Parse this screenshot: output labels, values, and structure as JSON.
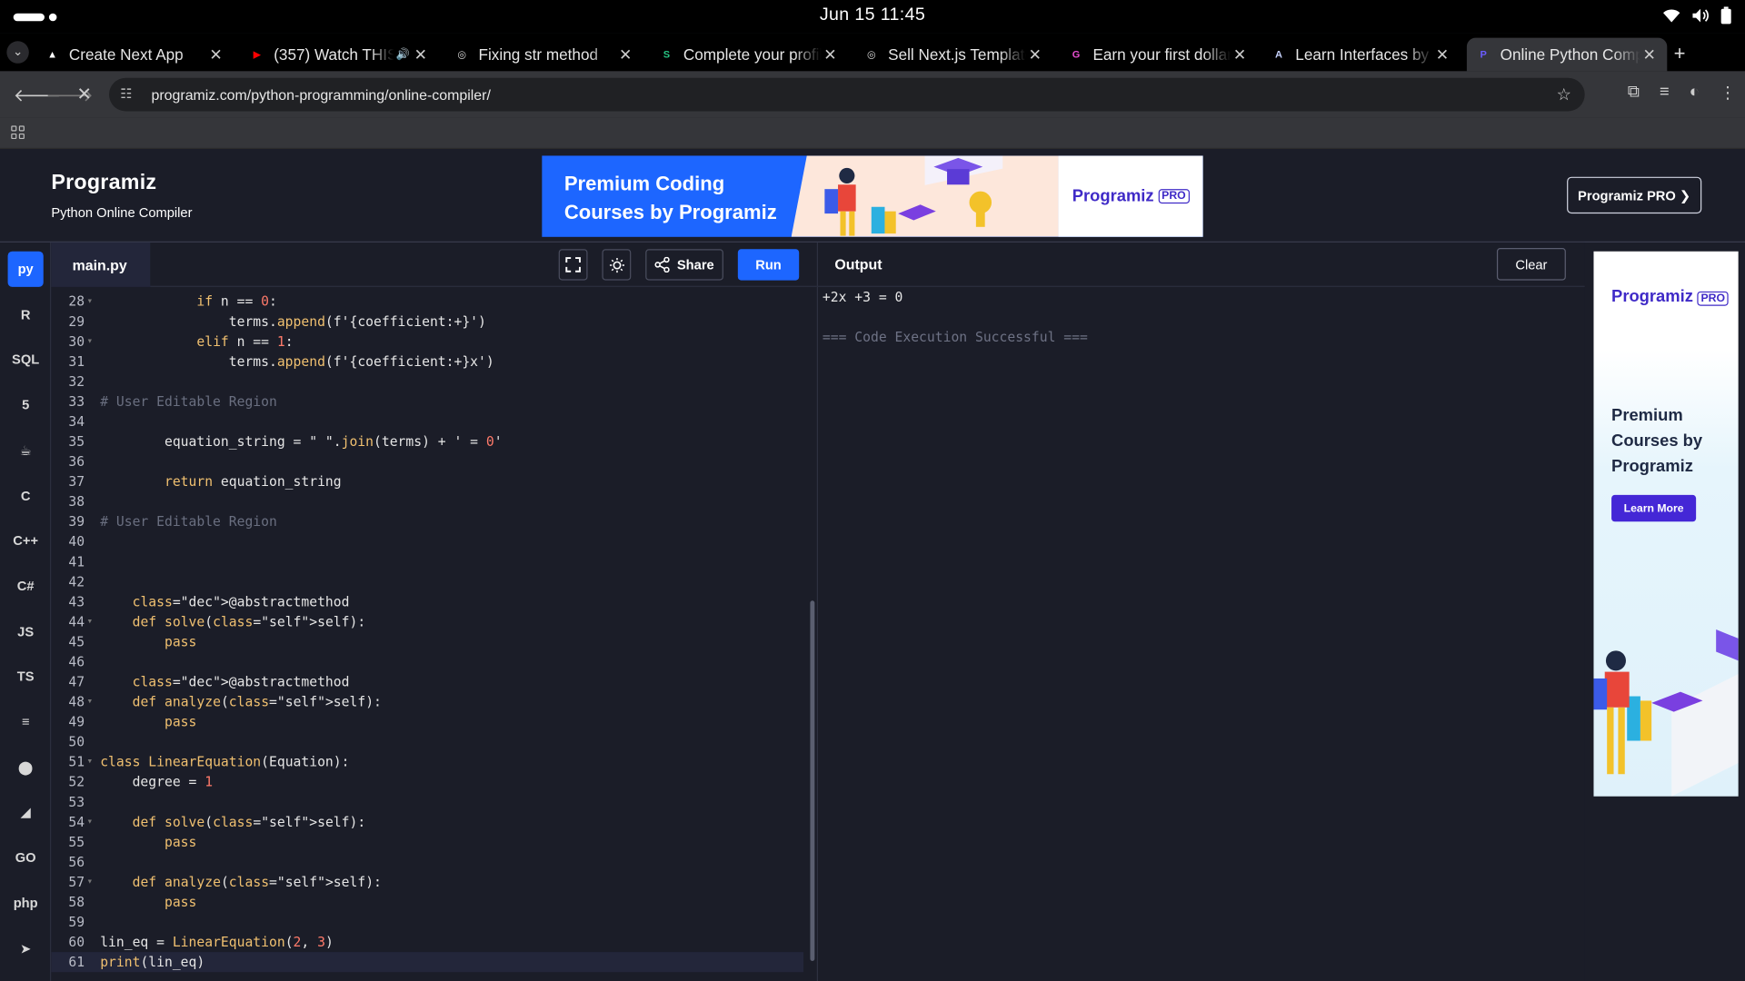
{
  "os": {
    "clock": "Jun 15  11:45"
  },
  "tabs": [
    {
      "title": "Create Next App",
      "fav_color": "#ffffff",
      "fav_glyph": "▲"
    },
    {
      "title": "(357) Watch THIS",
      "fav_color": "#ff0000",
      "fav_glyph": "▶"
    },
    {
      "title": "Fixing str method",
      "fav_color": "#d8d8d8",
      "fav_glyph": "◎"
    },
    {
      "title": "Complete your profile",
      "fav_color": "#26c281",
      "fav_glyph": "S"
    },
    {
      "title": "Sell Next.js Templates",
      "fav_color": "#d8d8d8",
      "fav_glyph": "◎"
    },
    {
      "title": "Earn your first dollar",
      "fav_color": "#e84fd1",
      "fav_glyph": "G"
    },
    {
      "title": "Learn Interfaces by",
      "fav_color": "#c7d2ff",
      "fav_glyph": "A"
    },
    {
      "title": "Online Python Compiler",
      "fav_color": "#6a5cff",
      "fav_glyph": "P"
    }
  ],
  "address": {
    "url": "programiz.com/python-programming/online-compiler/"
  },
  "header": {
    "logo": "Programiz",
    "subtitle": "Python Online Compiler",
    "banner_text": "Premium Coding Courses by Programiz",
    "banner_logo": "Programiz",
    "banner_pro": "PRO",
    "pro_button": "Programiz PRO ❯"
  },
  "rail": [
    "py",
    "R",
    "SQL",
    "5",
    "☕",
    "C",
    "C++",
    "C#",
    "JS",
    "TS",
    "≡",
    "⬤",
    "◢",
    "GO",
    "php",
    "➤"
  ],
  "editor": {
    "filename": "main.py",
    "share_label": "Share",
    "run_label": "Run",
    "lines": [
      {
        "n": "28",
        "fold": true
      },
      {
        "n": "29",
        "fold": false
      },
      {
        "n": "30",
        "fold": true
      },
      {
        "n": "31",
        "fold": false
      },
      {
        "n": "32",
        "fold": false
      },
      {
        "n": "33",
        "fold": false
      },
      {
        "n": "34",
        "fold": false
      },
      {
        "n": "35",
        "fold": false
      },
      {
        "n": "36",
        "fold": false
      },
      {
        "n": "37",
        "fold": false
      },
      {
        "n": "38",
        "fold": false
      },
      {
        "n": "39",
        "fold": false
      },
      {
        "n": "40",
        "fold": false
      },
      {
        "n": "41",
        "fold": false
      },
      {
        "n": "42",
        "fold": false
      },
      {
        "n": "43",
        "fold": false
      },
      {
        "n": "44",
        "fold": true
      },
      {
        "n": "45",
        "fold": false
      },
      {
        "n": "46",
        "fold": false
      },
      {
        "n": "47",
        "fold": false
      },
      {
        "n": "48",
        "fold": true
      },
      {
        "n": "49",
        "fold": false
      },
      {
        "n": "50",
        "fold": false
      },
      {
        "n": "51",
        "fold": true
      },
      {
        "n": "52",
        "fold": false
      },
      {
        "n": "53",
        "fold": false
      },
      {
        "n": "54",
        "fold": true
      },
      {
        "n": "55",
        "fold": false
      },
      {
        "n": "56",
        "fold": false
      },
      {
        "n": "57",
        "fold": true
      },
      {
        "n": "58",
        "fold": false
      },
      {
        "n": "59",
        "fold": false
      },
      {
        "n": "60",
        "fold": false
      },
      {
        "n": "61",
        "fold": false
      }
    ],
    "code": [
      "            if n == 0:",
      "                terms.append(f'{coefficient:+}')",
      "            elif n == 1:",
      "                terms.append(f'{coefficient:+}x')",
      "",
      "# User Editable Region",
      "",
      "        equation_string = \" \".join(terms) + ' = 0'",
      "",
      "        return equation_string",
      "",
      "# User Editable Region",
      "",
      "",
      "",
      "    @abstractmethod",
      "    def solve(self):",
      "        pass",
      "",
      "    @abstractmethod",
      "    def analyze(self):",
      "        pass",
      "",
      "class LinearEquation(Equation):",
      "    degree = 1",
      "",
      "    def solve(self):",
      "        pass",
      "",
      "    def analyze(self):",
      "        pass",
      "",
      "lin_eq = LinearEquation(2, 3)",
      "print(lin_eq)"
    ]
  },
  "output": {
    "title": "Output",
    "clear_label": "Clear",
    "lines": [
      "+2x +3 = 0",
      "",
      "=== Code Execution Successful ==="
    ]
  },
  "side_ad": {
    "logo": "Programiz",
    "pro": "PRO",
    "text": "Premium Courses by Programiz",
    "button": "Learn More"
  }
}
